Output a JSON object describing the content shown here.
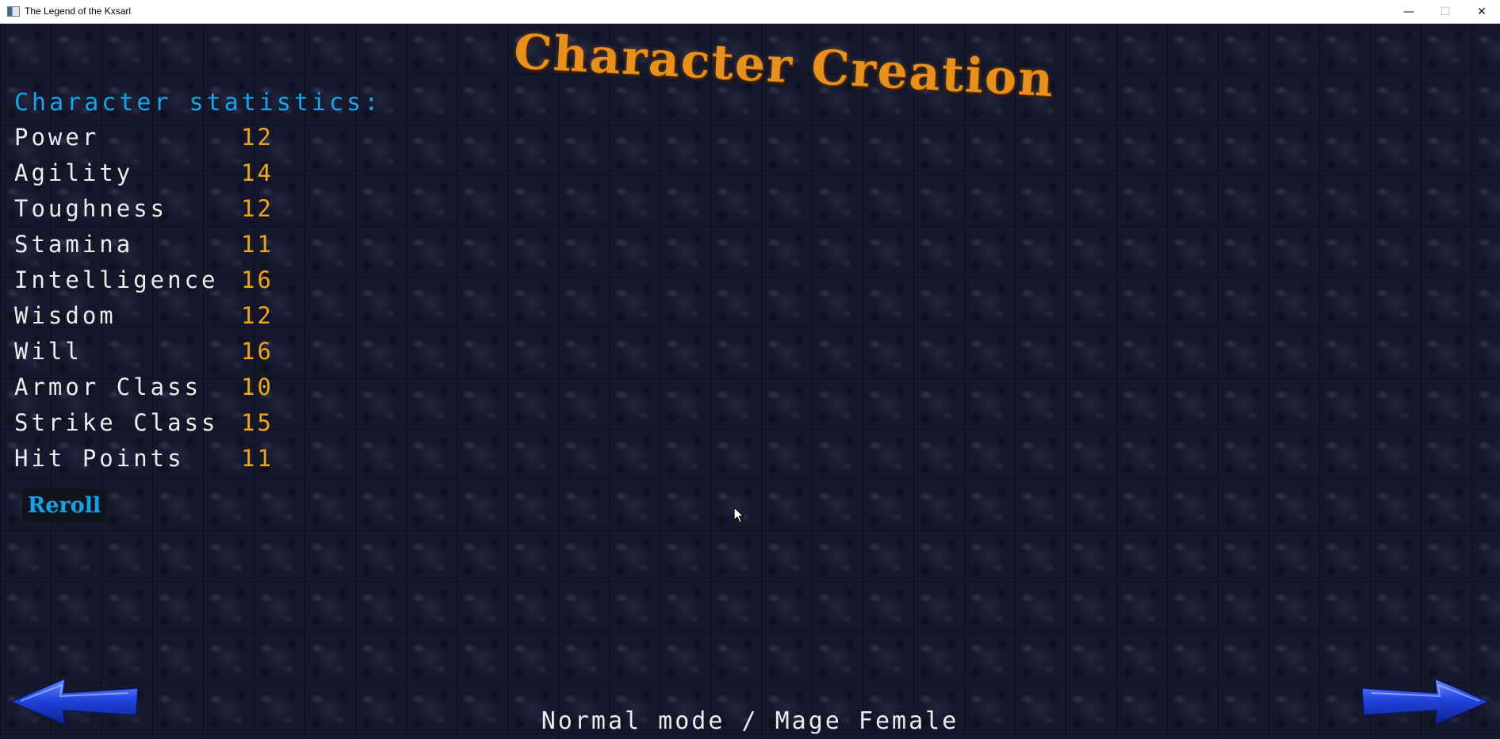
{
  "window": {
    "title": "The Legend of the Kxsarl",
    "controls": {
      "minimize": "—",
      "maximize": "☐",
      "close": "✕"
    }
  },
  "screen": {
    "heading": "Character Creation",
    "section_title": "Character statistics:",
    "stats": [
      {
        "label": "Power",
        "value": "12"
      },
      {
        "label": "Agility",
        "value": "14"
      },
      {
        "label": "Toughness",
        "value": "12"
      },
      {
        "label": "Stamina",
        "value": "11"
      },
      {
        "label": "Intelligence",
        "value": "16"
      },
      {
        "label": "Wisdom",
        "value": "12"
      },
      {
        "label": "Will",
        "value": "16"
      },
      {
        "label": "Armor Class",
        "value": "10"
      },
      {
        "label": "Strike Class",
        "value": "15"
      },
      {
        "label": "Hit Points",
        "value": "11"
      }
    ],
    "reroll_label": "Reroll",
    "mode_text": "Normal mode / Mage Female",
    "nav": {
      "back_icon": "left-arrow-icon",
      "next_icon": "right-arrow-icon"
    }
  },
  "colors": {
    "heading": "#e7901c",
    "section_title": "#17a6ea",
    "stat_label": "#ececec",
    "stat_value": "#f0a51a",
    "reroll": "#1aa0e0",
    "arrow": "#1c3fd8"
  }
}
